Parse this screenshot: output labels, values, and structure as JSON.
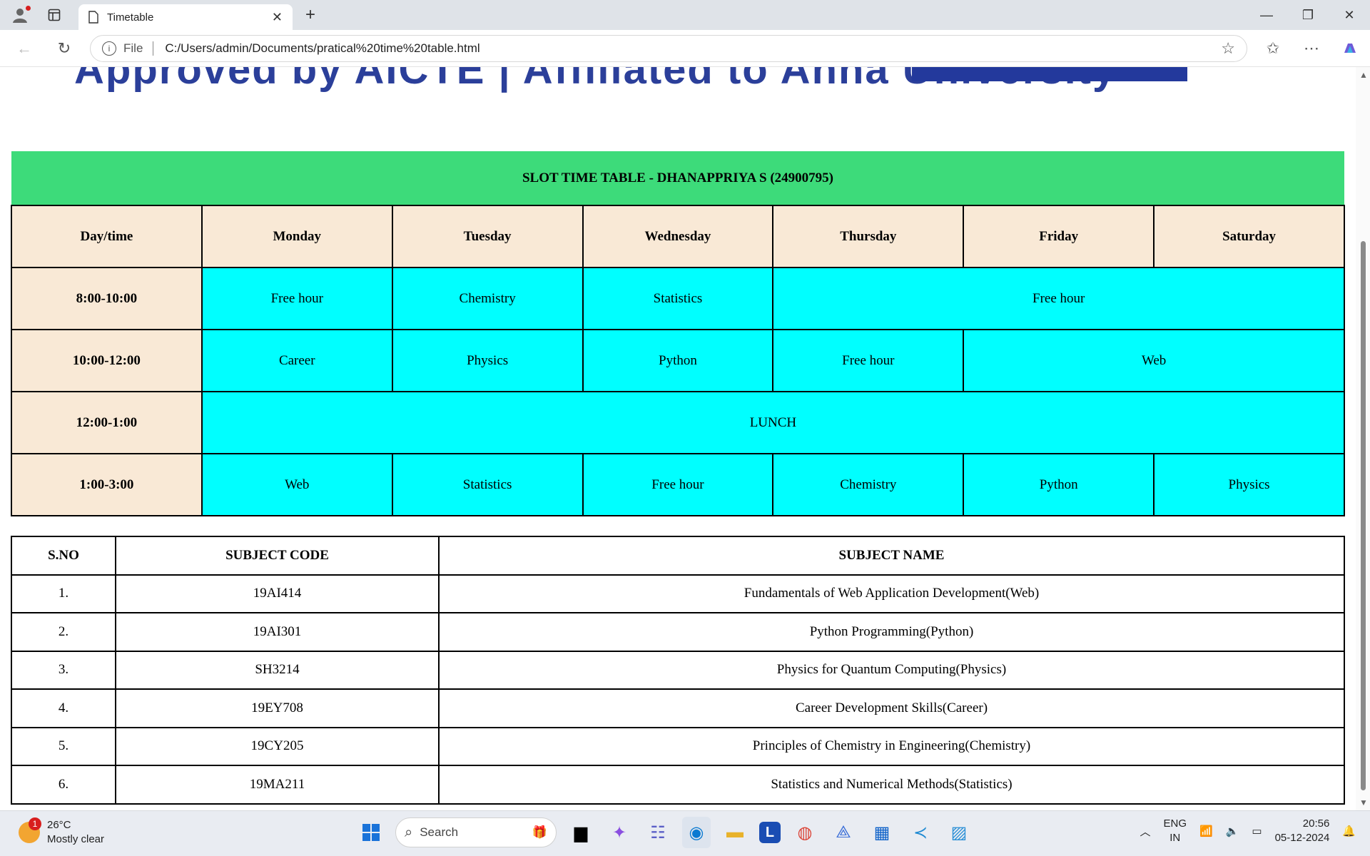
{
  "browser": {
    "tab_title": "Timetable",
    "url_scheme": "File",
    "url": "C:/Users/admin/Documents/pratical%20time%20table.html"
  },
  "banner": {
    "text": "Approved by AICTE | Affiliated to Anna University"
  },
  "timetable": {
    "caption": "SLOT TIME TABLE - DHANAPPRIYA S (24900795)",
    "corner": "Day/time",
    "days": [
      "Monday",
      "Tuesday",
      "Wednesday",
      "Thursday",
      "Friday",
      "Saturday"
    ],
    "rows": [
      {
        "time": "8:00-10:00",
        "cells": [
          "Free hour",
          "Chemistry",
          "Statistics",
          "Free hour"
        ]
      },
      {
        "time": "10:00-12:00",
        "cells": [
          "Career",
          "Physics",
          "Python",
          "Free hour",
          "Web"
        ]
      },
      {
        "time": "12:00-1:00",
        "cells": [
          "LUNCH"
        ]
      },
      {
        "time": "1:00-3:00",
        "cells": [
          "Web",
          "Statistics",
          "Free hour",
          "Chemistry",
          "Python",
          "Physics"
        ]
      }
    ]
  },
  "subjects": {
    "headers": [
      "S.NO",
      "SUBJECT CODE",
      "SUBJECT NAME"
    ],
    "rows": [
      [
        "1.",
        "19AI414",
        "Fundamentals of Web Application Development(Web)"
      ],
      [
        "2.",
        "19AI301",
        "Python Programming(Python)"
      ],
      [
        "3.",
        "SH3214",
        "Physics for Quantum Computing(Physics)"
      ],
      [
        "4.",
        "19EY708",
        "Career Development Skills(Career)"
      ],
      [
        "5.",
        "19CY205",
        "Principles of Chemistry in Engineering(Chemistry)"
      ],
      [
        "6.",
        "19MA211",
        "Statistics and Numerical Methods(Statistics)"
      ]
    ]
  },
  "taskbar": {
    "weather_temp": "26°C",
    "weather_desc": "Mostly clear",
    "weather_badge": "1",
    "search_label": "Search",
    "lang_top": "ENG",
    "lang_bottom": "IN",
    "time": "20:56",
    "date": "05-12-2024"
  },
  "colors": {
    "caption_bg": "#3ddb7a",
    "header_bg": "#f9e9d6",
    "slot_bg": "#00ffff"
  }
}
